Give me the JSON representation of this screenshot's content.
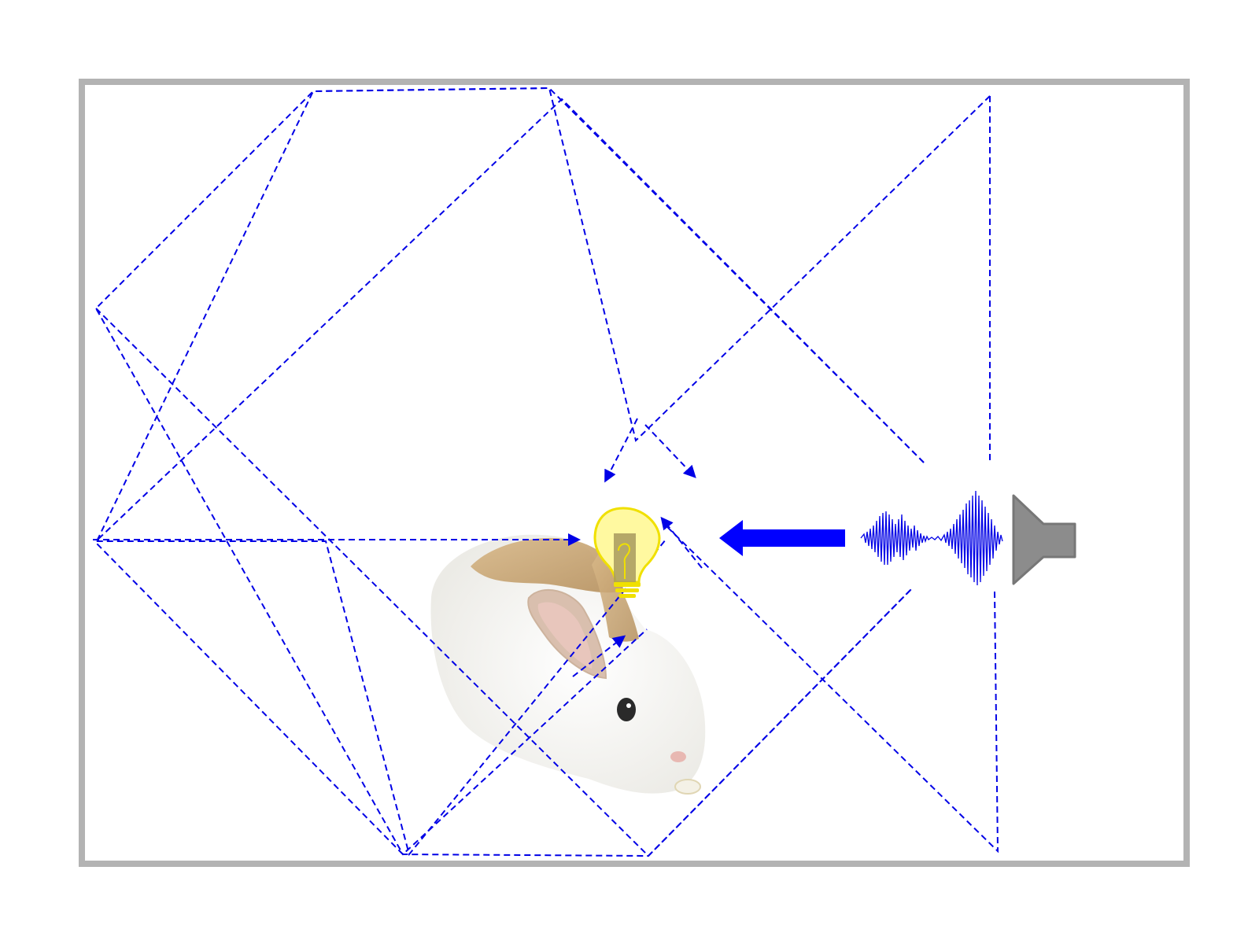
{
  "diagram": {
    "subject": "rabbit",
    "listener_icon": "light-bulb-icon",
    "source_icon": "loudspeaker-icon",
    "signal_icon": "sound-waveform-icon",
    "direct_arrow_icon": "thick-left-arrow-icon",
    "ray_style": "dashed",
    "ray_paths": [
      "direct",
      "left-wall-bounce",
      "multi-bounce-upper",
      "multi-bounce-lower"
    ]
  },
  "colors": {
    "ray": "#0000e6",
    "direct_arrow": "#0000ff",
    "waveform": "#0000e6",
    "room_border": "#b3b3b3",
    "bulb_fill": "#fff9a0",
    "bulb_stroke": "#f0e000",
    "bulb_base": "#a89a5e",
    "speaker": "#8c8c8c",
    "speaker_stroke": "#777777",
    "rabbit_fur": "#f7f5f1",
    "rabbit_patch": "#c9a878",
    "background": "#ffffff"
  }
}
